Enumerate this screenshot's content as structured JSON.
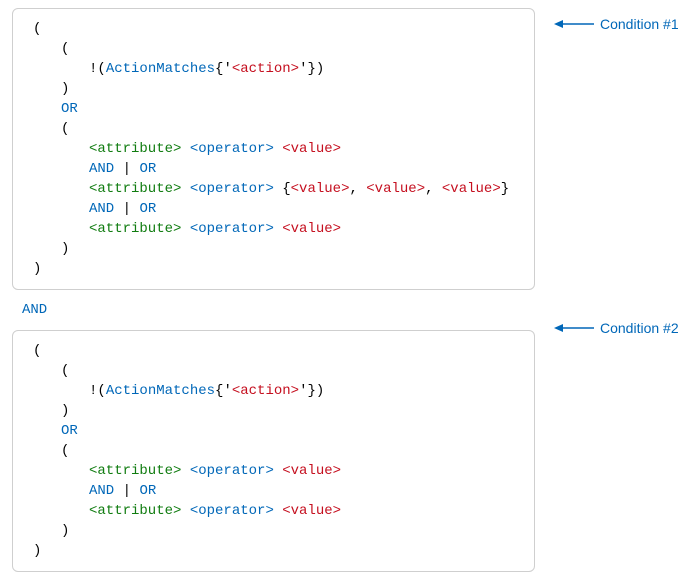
{
  "colors": {
    "blue": "#0067b8",
    "green": "#107c10",
    "red": "#c50f1f"
  },
  "tokens": {
    "open_paren": "(",
    "close_paren": ")",
    "bang": "!",
    "action_matches": "ActionMatches",
    "open_brace": "{",
    "close_brace": "}",
    "quote": "'",
    "action_placeholder": "<action>",
    "attribute": "<attribute>",
    "operator": "<operator>",
    "value": "<value>",
    "comma_sp": ", ",
    "pipe": " | ",
    "and": "AND",
    "or": "OR"
  },
  "connector": "AND",
  "annotations": {
    "c1": "Condition #1",
    "c2": "Condition #2"
  }
}
